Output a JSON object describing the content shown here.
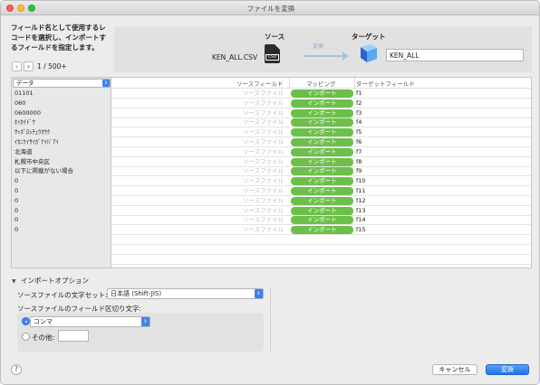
{
  "window": {
    "title": "ファイルを変換"
  },
  "instructions": "フィールド名として使用するレコードを選択し、インポートするフィールドを指定します。",
  "record_nav": {
    "prev": "‹",
    "next": "›",
    "count": "1 / 500+"
  },
  "source": {
    "title": "ソース",
    "file_name": "KEN_ALL.CSV",
    "icon_label": "CSV"
  },
  "conversion": {
    "label": "変換"
  },
  "target": {
    "title": "ターゲット",
    "name": "KEN_ALL"
  },
  "table": {
    "data_column": "データ",
    "headers": {
      "source_field": "ソースフィールド",
      "mapping": "マッピング",
      "target_field": "ターゲットフィールド"
    },
    "rows": [
      {
        "data": "01101",
        "source": "ソースファイル",
        "mapping": "インポート",
        "target": "f1"
      },
      {
        "data": "060",
        "source": "ソースファイル",
        "mapping": "インポート",
        "target": "f2"
      },
      {
        "data": "0600000",
        "source": "ソースファイル",
        "mapping": "インポート",
        "target": "f3"
      },
      {
        "data": "ﾎｯｶｲﾄﾞｳ",
        "source": "ソースファイル",
        "mapping": "インポート",
        "target": "f4"
      },
      {
        "data": "ｻｯﾎﾟﾛｼﾁｭｳｵｳｸ",
        "source": "ソースファイル",
        "mapping": "インポート",
        "target": "f5"
      },
      {
        "data": "ｲｶﾆｹｲｻｲｶﾞﾅｲﾊﾞｱｲ",
        "source": "ソースファイル",
        "mapping": "インポート",
        "target": "f6"
      },
      {
        "data": "北海道",
        "source": "ソースファイル",
        "mapping": "インポート",
        "target": "f7"
      },
      {
        "data": "札幌市中央区",
        "source": "ソースファイル",
        "mapping": "インポート",
        "target": "f8"
      },
      {
        "data": "以下に掲載がない場合",
        "source": "ソースファイル",
        "mapping": "インポート",
        "target": "f9"
      },
      {
        "data": "0",
        "source": "ソースファイル",
        "mapping": "インポート",
        "target": "f10"
      },
      {
        "data": "0",
        "source": "ソースファイル",
        "mapping": "インポート",
        "target": "f11"
      },
      {
        "data": "0",
        "source": "ソースファイル",
        "mapping": "インポート",
        "target": "f12"
      },
      {
        "data": "0",
        "source": "ソースファイル",
        "mapping": "インポート",
        "target": "f13"
      },
      {
        "data": "0",
        "source": "ソースファイル",
        "mapping": "インポート",
        "target": "f14"
      },
      {
        "data": "0",
        "source": "ソースファイル",
        "mapping": "インポート",
        "target": "f15"
      }
    ]
  },
  "import_options": {
    "toggle_label": "インポートオプション",
    "charset_label": "ソースファイルの文字セット:",
    "charset_value": "日本語 (Shift-JIS)",
    "delimiter_label": "ソースファイルのフィールド区切り文字:",
    "delimiter_value": "コンマ",
    "other_label": "その他:",
    "other_value": ""
  },
  "buttons": {
    "help": "?",
    "cancel": "キャンセル",
    "convert": "変換"
  },
  "colors": {
    "accent": "#3c82f2",
    "import_green": "#6cc04a",
    "arrow": "#a7c1e0"
  }
}
